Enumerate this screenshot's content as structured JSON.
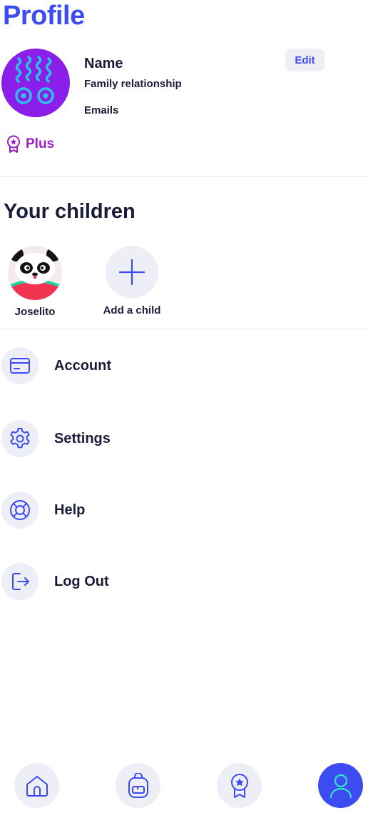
{
  "header": {
    "title": "Profile"
  },
  "profile": {
    "name": "Name",
    "relationship": "Family relationship",
    "emails": "Emails",
    "edit_label": "Edit",
    "plan": "Plus"
  },
  "children_section": {
    "title": "Your children",
    "children": [
      {
        "name": "Joselito"
      }
    ],
    "add_label": "Add a child"
  },
  "menu": {
    "items": [
      {
        "label": "Account",
        "icon": "card-icon"
      },
      {
        "label": "Settings",
        "icon": "gear-icon"
      },
      {
        "label": "Help",
        "icon": "lifebuoy-icon"
      },
      {
        "label": "Log Out",
        "icon": "logout-icon"
      }
    ]
  },
  "bottom_nav": {
    "items": [
      {
        "icon": "home-icon"
      },
      {
        "icon": "backpack-icon"
      },
      {
        "icon": "award-icon"
      },
      {
        "icon": "profile-icon",
        "active": true
      }
    ]
  },
  "colors": {
    "accent": "#3c4cf0",
    "plan": "#9b1fc1",
    "icon_bg": "#eeeef7",
    "text": "#1b1b3a"
  }
}
